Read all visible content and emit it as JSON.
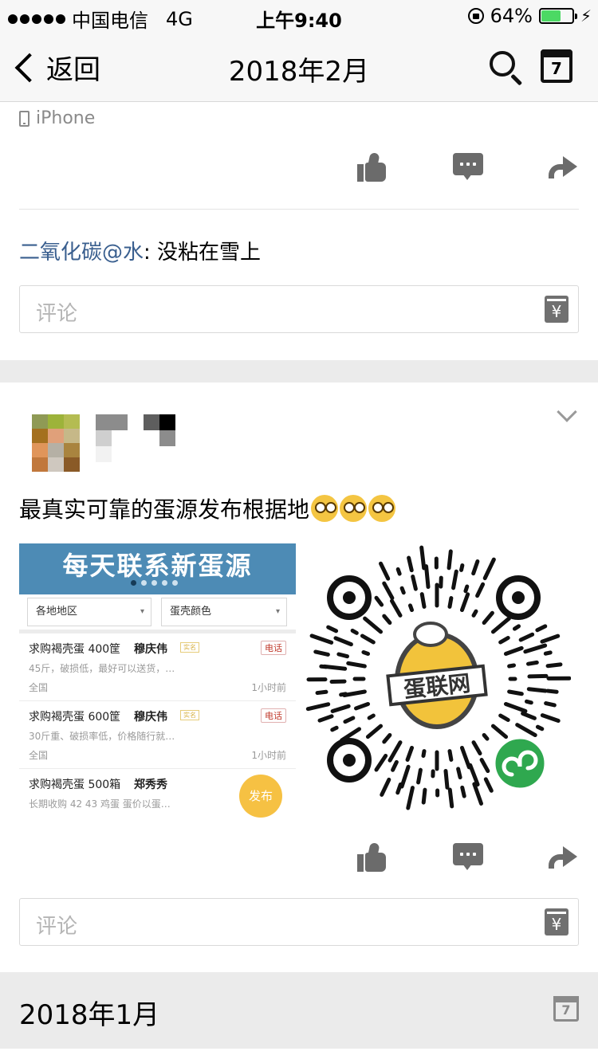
{
  "status_bar": {
    "carrier": "中国电信",
    "network": "4G",
    "time": "上午9:40",
    "battery": "64%",
    "battery_level": 0.64
  },
  "navbar": {
    "back_label": "返回",
    "title": "2018年2月",
    "calendar_day": "7"
  },
  "post1": {
    "source": "iPhone",
    "comment": {
      "user": "二氧化碳@水",
      "separator": ": ",
      "text": "没粘在雪上"
    },
    "comment_placeholder": "评论",
    "yen_label": "¥"
  },
  "post2": {
    "text": "最真实可靠的蛋源发布根据地",
    "embedded_app": {
      "banner": "每天联系新蛋源",
      "filters": [
        "各地地区",
        "蛋壳颜色"
      ],
      "rows": [
        {
          "title": "求购褐壳蛋 400筐",
          "name": "穆庆伟",
          "tag": "实名",
          "call": "电话",
          "desc": "45斤，破损低，最好可以送货，…",
          "location": "全国",
          "time": "1小时前"
        },
        {
          "title": "求购褐壳蛋 600筐",
          "name": "穆庆伟",
          "tag": "实名",
          "call": "电话",
          "desc": "30斤重、破损率低，价格随行就…",
          "location": "全国",
          "time": "1小时前"
        },
        {
          "title": "求购褐壳蛋 500箱",
          "name": "郑秀秀",
          "tag": "",
          "call": "",
          "desc": "长期收购 42 43 鸡蛋 蛋价以蛋…",
          "location": "",
          "time": ""
        }
      ],
      "fab": "发布"
    },
    "qr_logo_text": "蛋联网",
    "comment_placeholder": "评论",
    "yen_label": "¥"
  },
  "next_month": {
    "label": "2018年1月",
    "calendar_day": "7"
  },
  "colors": {
    "link_blue": "#3a5f8f",
    "banner_blue": "#4d8bb5",
    "fab_yellow": "#f6c143",
    "battery_green": "#4cd964",
    "icon_gray": "#6b6b6b",
    "band_gray": "#ebebeb"
  },
  "icons": [
    "search-icon",
    "calendar-icon",
    "back-chevron-icon",
    "like-icon",
    "comment-icon",
    "share-icon",
    "yen-icon",
    "dropdown-chevron-icon",
    "phone-icon"
  ]
}
